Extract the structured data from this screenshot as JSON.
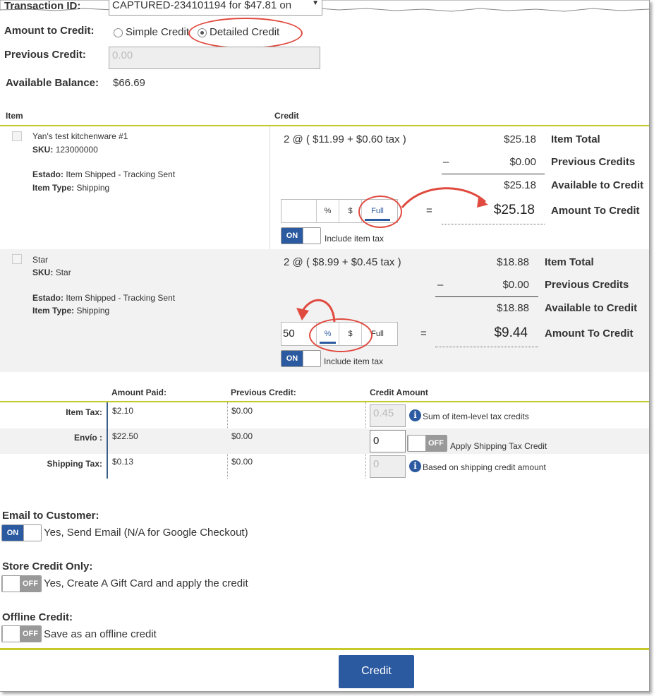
{
  "header": {
    "transaction_id_label": "Transaction ID:",
    "transaction_id_value": "CAPTURED-234101194 for $47.81 on",
    "amount_to_credit_label": "Amount to Credit:",
    "simple_credit_label": "Simple Credit",
    "detailed_credit_label": "Detailed Credit",
    "previous_credit_label": "Previous Credit:",
    "previous_credit_value": "0.00",
    "available_balance_label": "Available Balance:",
    "available_balance_value": "$66.69"
  },
  "items_table": {
    "col_item": "Item",
    "col_credit": "Credit",
    "items": [
      {
        "name": "Yan's test kitchenware #1",
        "sku_label": "SKU:",
        "sku": "123000000",
        "estado_label": "Estado:",
        "estado": "Item Shipped - Tracking Sent",
        "type_label": "Item Type:",
        "type": "Shipping",
        "qty_price": "2 @ ( $11.99 + $0.60 tax )",
        "item_total": "$25.18",
        "item_total_label": "Item Total",
        "minus": "–",
        "previous_credits": "$0.00",
        "previous_credits_label": "Previous Credits",
        "available": "$25.18",
        "available_label": "Available to Credit",
        "input_value": "",
        "pct": "%",
        "dollar": "$",
        "full": "Full",
        "equals": "=",
        "amount": "$25.18",
        "amount_label": "Amount To Credit",
        "toggle_on": "ON",
        "include_tax": "Include item tax"
      },
      {
        "name": "Star",
        "sku_label": "SKU:",
        "sku": "Star",
        "estado_label": "Estado:",
        "estado": "Item Shipped - Tracking Sent",
        "type_label": "Item Type:",
        "type": "Shipping",
        "qty_price": "2 @ ( $8.99 + $0.45 tax )",
        "item_total": "$18.88",
        "item_total_label": "Item Total",
        "minus": "–",
        "previous_credits": "$0.00",
        "previous_credits_label": "Previous Credits",
        "available": "$18.88",
        "available_label": "Available to Credit",
        "input_value": "50",
        "pct": "%",
        "dollar": "$",
        "full": "Full",
        "equals": "=",
        "amount": "$9.44",
        "amount_label": "Amount To Credit",
        "toggle_on": "ON",
        "include_tax": "Include item tax"
      }
    ]
  },
  "summary_table": {
    "col_amount_paid": "Amount Paid:",
    "col_previous_credit": "Previous Credit:",
    "col_credit_amount": "Credit Amount",
    "rows": [
      {
        "label": "Item Tax:",
        "paid": "$2.10",
        "previous": "$0.00",
        "credit": "0.45",
        "note": "Sum of item-level tax credits"
      },
      {
        "label": "Envío :",
        "paid": "$22.50",
        "previous": "$0.00",
        "credit": "0",
        "toggle_off": "OFF",
        "note": "Apply Shipping Tax Credit"
      },
      {
        "label": "Shipping Tax:",
        "paid": "$0.13",
        "previous": "$0.00",
        "credit": "0",
        "note": "Based on shipping credit amount"
      }
    ]
  },
  "options": {
    "email_label": "Email to Customer:",
    "email_toggle": "ON",
    "email_text": "Yes, Send Email (N/A for Google Checkout)",
    "store_credit_label": "Store Credit Only:",
    "store_credit_toggle": "OFF",
    "store_credit_text": "Yes, Create A Gift Card and apply the credit",
    "offline_label": "Offline Credit:",
    "offline_toggle": "OFF",
    "offline_text": "Save as an offline credit"
  },
  "footer": {
    "credit_button": "Credit"
  },
  "colors": {
    "accent": "#2c5aa0",
    "separator": "#c5c92a",
    "annotation": "#e04a3f"
  }
}
